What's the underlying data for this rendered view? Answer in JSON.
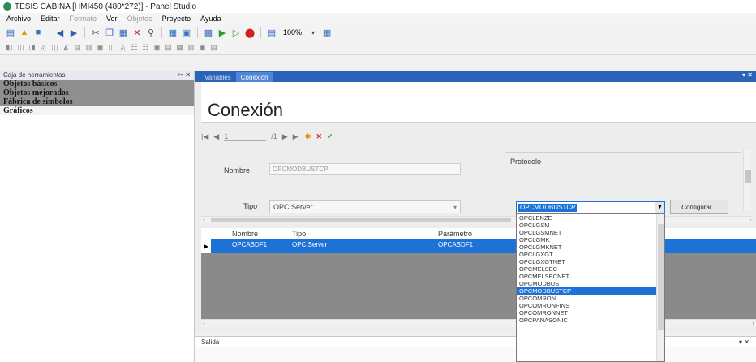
{
  "window": {
    "title": "TESIS CABINA [HMI450 (480*272)] - Panel Studio"
  },
  "menu": [
    {
      "label": "Archivo",
      "disabled": false
    },
    {
      "label": "Editar",
      "disabled": false
    },
    {
      "label": "Formato",
      "disabled": true
    },
    {
      "label": "Ver",
      "disabled": false
    },
    {
      "label": "Objetos",
      "disabled": true
    },
    {
      "label": "Proyecto",
      "disabled": false
    },
    {
      "label": "Ayuda",
      "disabled": false
    }
  ],
  "toolbar": {
    "zoom": "100%"
  },
  "toolbox": {
    "title": "Caja de herramientas",
    "pin": "✂ ✕",
    "items": [
      {
        "label": "Objetos básicos"
      },
      {
        "label": "Objetos mejorados"
      },
      {
        "label": "Fábrica de símbolos"
      },
      {
        "label": "Gráficos"
      }
    ]
  },
  "tabs": [
    {
      "label": "Variables",
      "active": false
    },
    {
      "label": "Conexión",
      "active": true
    }
  ],
  "pane_controls": "▾ ✕",
  "header": {
    "title": "Conexión"
  },
  "navigator": {
    "position": "1",
    "total": "/1"
  },
  "form": {
    "name_label": "Nombre",
    "name_value": "OPCMODBUSTCP",
    "type_label": "Tipo",
    "type_value": "OPC Server",
    "protocol_label": "Protocolo",
    "protocol_value": "OPCMODBUSTCP",
    "configure_label": "Configurar..."
  },
  "grid": {
    "columns": [
      "Nombre",
      "Tipo",
      "Parámetro"
    ],
    "rows": [
      [
        "OPCABDF1",
        "OPC Server",
        "OPCABDF1"
      ]
    ]
  },
  "output": {
    "title": "Salida",
    "controls": "▾ ✕"
  },
  "dropdown_options": [
    "OPCLENZE",
    "OPCLGSM",
    "OPCLGSMNET",
    "OPCLGMK",
    "OPCLGMKNET",
    "OPCLGXGT",
    "OPCLGXGTNET",
    "OPCMELSEC",
    "OPCMELSECNET",
    "OPCMODBUS",
    "OPCMODBUSTCP",
    "OPCOMRON",
    "OPCOMRONFINS",
    "OPCOMRONNET",
    "OPCPANASONIC"
  ],
  "dropdown_selected_index": 10,
  "colors": {
    "accent": "#1d72d8",
    "tabbar": "#2a63b7",
    "toolbox_group": "#8f8f8f"
  }
}
